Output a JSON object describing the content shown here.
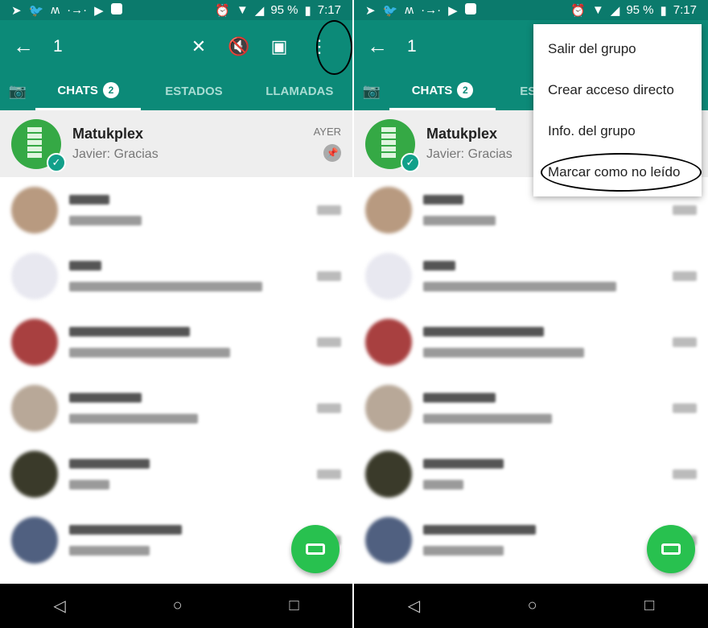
{
  "status": {
    "battery": "95 %",
    "time": "7:17"
  },
  "toolbar": {
    "selected_count": "1",
    "back_icon": "arrow-left-icon",
    "actions": [
      "unpin-icon",
      "mute-icon",
      "archive-icon",
      "more-vert-icon"
    ]
  },
  "tabs": {
    "chats": "CHATS",
    "chats_badge": "2",
    "estados": "ESTADOS",
    "llamadas": "LLAMADAS"
  },
  "selected_chat": {
    "name": "Matukplex",
    "preview": "Javier: Gracias",
    "time": "AYER",
    "pinned": true
  },
  "blurred_avatars": [
    "#b89a80",
    "#e8e8f0",
    "#a84040",
    "#b8a898",
    "#3a3a2a",
    "#506080"
  ],
  "menu": [
    "Salir del grupo",
    "Crear acceso directo",
    "Info. del grupo",
    "Marcar como no leído"
  ],
  "colors": {
    "primary": "#0c8a78",
    "status_bar": "#0b7a6c",
    "fab": "#28c14f"
  }
}
